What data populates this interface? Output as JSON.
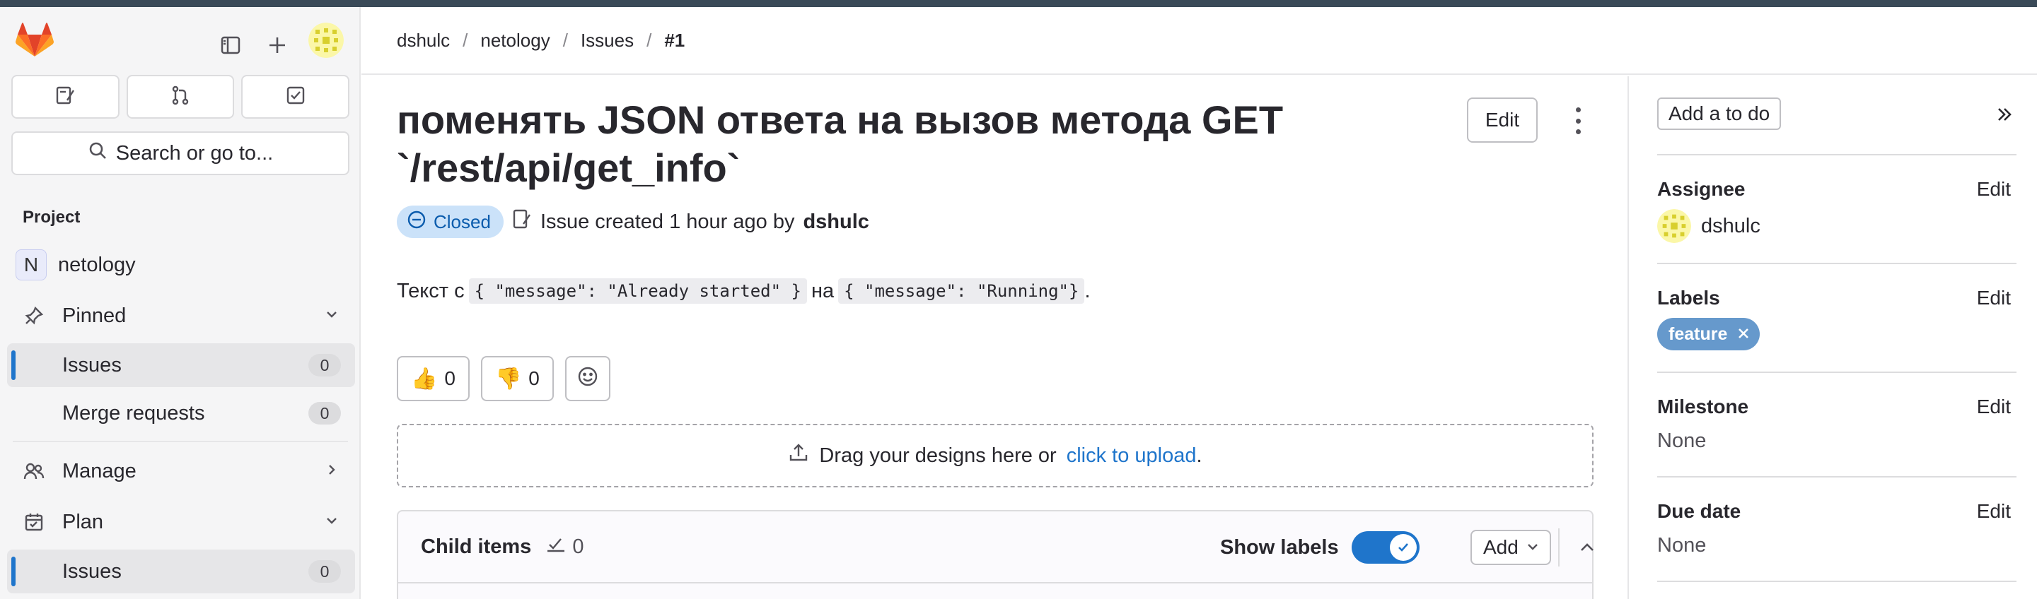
{
  "breadcrumb": [
    "dshulc",
    "netology",
    "Issues",
    "#1"
  ],
  "sidebar": {
    "search_label": "Search or go to...",
    "section": "Project",
    "project_name": "netology",
    "project_initial": "N",
    "pinned_label": "Pinned",
    "pinned_items": [
      {
        "label": "Issues",
        "count": "0"
      },
      {
        "label": "Merge requests",
        "count": "0"
      }
    ],
    "manage_label": "Manage",
    "plan_label": "Plan",
    "plan_items": [
      {
        "label": "Issues",
        "count": "0"
      }
    ]
  },
  "issue": {
    "title": "поменять JSON ответа на вызов метода GET `/rest/api/get_info`",
    "edit_label": "Edit",
    "status": "Closed",
    "created_text": "Issue created 1 hour ago by",
    "author": "dshulc",
    "desc_prefix": "Текст с",
    "code1": "{ \"message\": \"Already started\" }",
    "desc_mid": "на",
    "code2": "{ \"message\": \"Running\"}",
    "desc_suffix": ".",
    "thumbs_up": "0",
    "thumbs_down": "0",
    "drop_text": "Drag your designs here or",
    "drop_link": "click to upload",
    "drop_suffix": "."
  },
  "child_items": {
    "title": "Child items",
    "count": "0",
    "show_labels": "Show labels",
    "add_label": "Add"
  },
  "rsidebar": {
    "todo_label": "Add a to do",
    "assignee": {
      "heading": "Assignee",
      "edit": "Edit",
      "name": "dshulc"
    },
    "labels": {
      "heading": "Labels",
      "edit": "Edit",
      "label": "feature",
      "color": "#6699cc"
    },
    "milestone": {
      "heading": "Milestone",
      "edit": "Edit",
      "value": "None"
    },
    "due_date": {
      "heading": "Due date",
      "edit": "Edit",
      "value": "None"
    }
  },
  "colors": {
    "accent": "#1f75cb",
    "closed_badge_bg": "#cbe2f9",
    "closed_badge_fg": "#0b5cad"
  }
}
